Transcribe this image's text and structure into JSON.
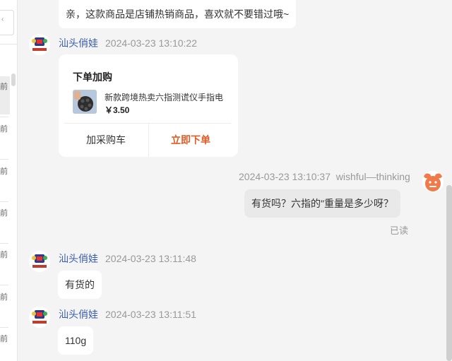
{
  "session_list": {
    "time_labels": [
      "前",
      "前",
      "前",
      "前",
      "前",
      "前",
      "前"
    ]
  },
  "messages": [
    {
      "text": "亲，这款商品是店铺热销商品，喜欢就不要错过哦~"
    },
    {
      "sender": "汕头俏娃",
      "time": "2024-03-23 13:10:22",
      "card": {
        "title": "下单加购",
        "product_name": "新款跨境热卖六指测谎仪手指电",
        "price": "￥3.50",
        "cart_button": "加采购车",
        "order_button": "立即下单"
      }
    },
    {
      "sender": "wishful—thinking",
      "time": "2024-03-23 13:10:37",
      "text": "有货吗？六指的\"重量是多少呀？",
      "status": "已读"
    },
    {
      "sender": "汕头俏娃",
      "time": "2024-03-23 13:11:48",
      "text": "有货的"
    },
    {
      "sender": "汕头俏娃",
      "time": "2024-03-23 13:11:51",
      "text": "110g"
    }
  ],
  "colors": {
    "accent_order": "#e35a24",
    "sender_name": "#3a5dad"
  }
}
